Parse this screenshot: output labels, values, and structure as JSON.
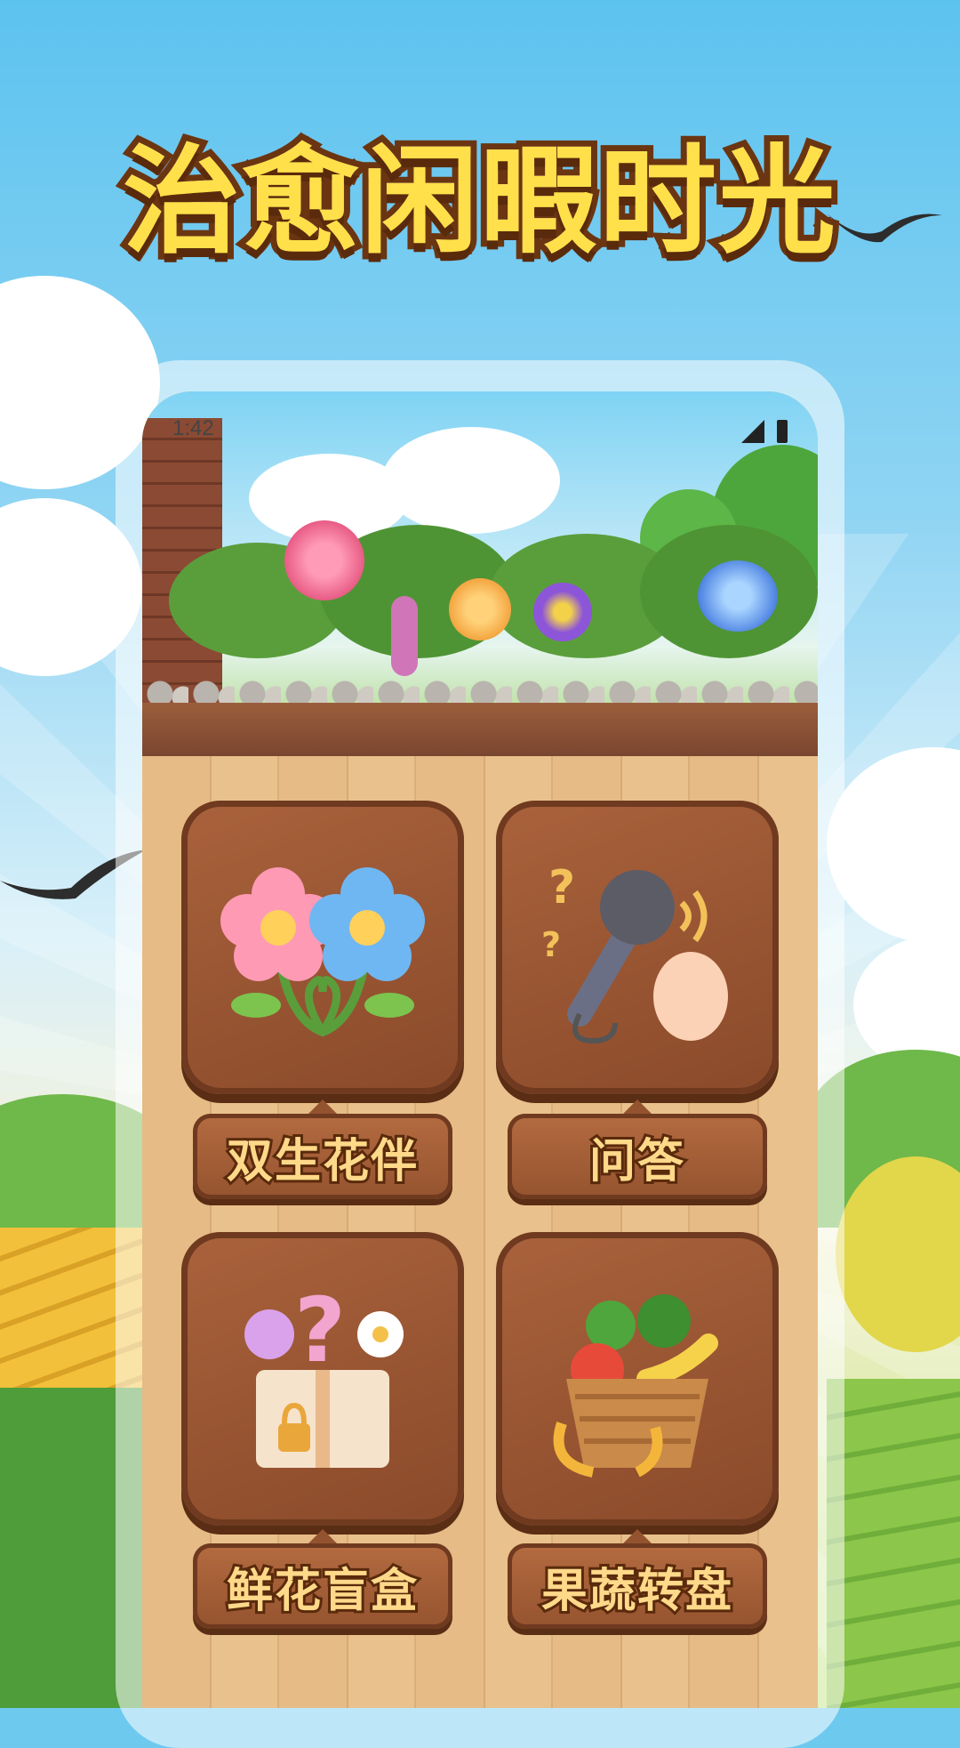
{
  "headline": "治愈闲暇时光",
  "status_bar": {
    "time": "1:42",
    "signal_icon": "signal-icon",
    "battery_icon": "battery-icon"
  },
  "menu": {
    "items": [
      {
        "label": "双生花伴",
        "icon": "twin-flowers-icon"
      },
      {
        "label": "问答",
        "icon": "microphone-qa-icon"
      },
      {
        "label": "鲜花盲盒",
        "icon": "flower-blind-box-icon"
      },
      {
        "label": "果蔬转盘",
        "icon": "fruit-vegetable-basket-icon"
      }
    ]
  },
  "colors": {
    "sky": "#5cc3ef",
    "headline_fill": "#ffe04a",
    "headline_stroke": "#6b3511",
    "wood": "#8a4a2a",
    "sign_text": "#ffd98a"
  }
}
